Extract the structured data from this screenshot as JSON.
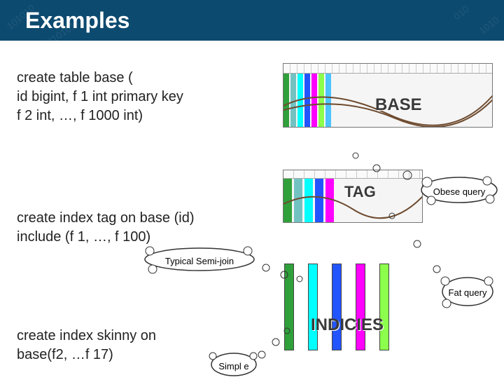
{
  "header": {
    "title": "Examples"
  },
  "code": {
    "block1_l1": "create table base (",
    "block1_l2": "  id bigint, f 1 int primary key",
    "block1_l3": "  f 2 int, …, f 1000 int)",
    "block2_l1": "create index tag  on base (id)",
    "block2_l2": "        include (f 1, …, f 100)",
    "block3_l1": "create index skinny on",
    "block3_l2": "  base(f2, …f 17)"
  },
  "labels": {
    "base": "BASE",
    "tag": "TAG",
    "indicies": "INDICIES"
  },
  "callouts": {
    "obese": "Obese query",
    "semi": "Typical Semi-join",
    "fat": "Fat query",
    "simple": "Simpl e"
  },
  "colors": {
    "c1": "#2fa03a",
    "c2": "#73c2c2",
    "c3": "#00ffff",
    "c4": "#2355ff",
    "c5": "#ff00ff",
    "c6": "#8cff4d",
    "c7": "#4dc3ff"
  },
  "chart_data": [
    {
      "type": "table",
      "name": "BASE",
      "title": "base table columns",
      "columns": [
        "id",
        "f1",
        "f2",
        "…",
        "f1000"
      ],
      "highlighted_left_columns": 7,
      "total_columns_approx": 1000
    },
    {
      "type": "table",
      "name": "TAG",
      "title": "tag covering index",
      "columns": [
        "id",
        "f1",
        "…",
        "f100"
      ],
      "highlighted_left_columns": 5,
      "total_columns_approx": 100
    },
    {
      "type": "table",
      "name": "INDICIES",
      "title": "skinny indices",
      "columns": [
        "f2",
        "…",
        "f17"
      ],
      "column_count": 5
    }
  ]
}
